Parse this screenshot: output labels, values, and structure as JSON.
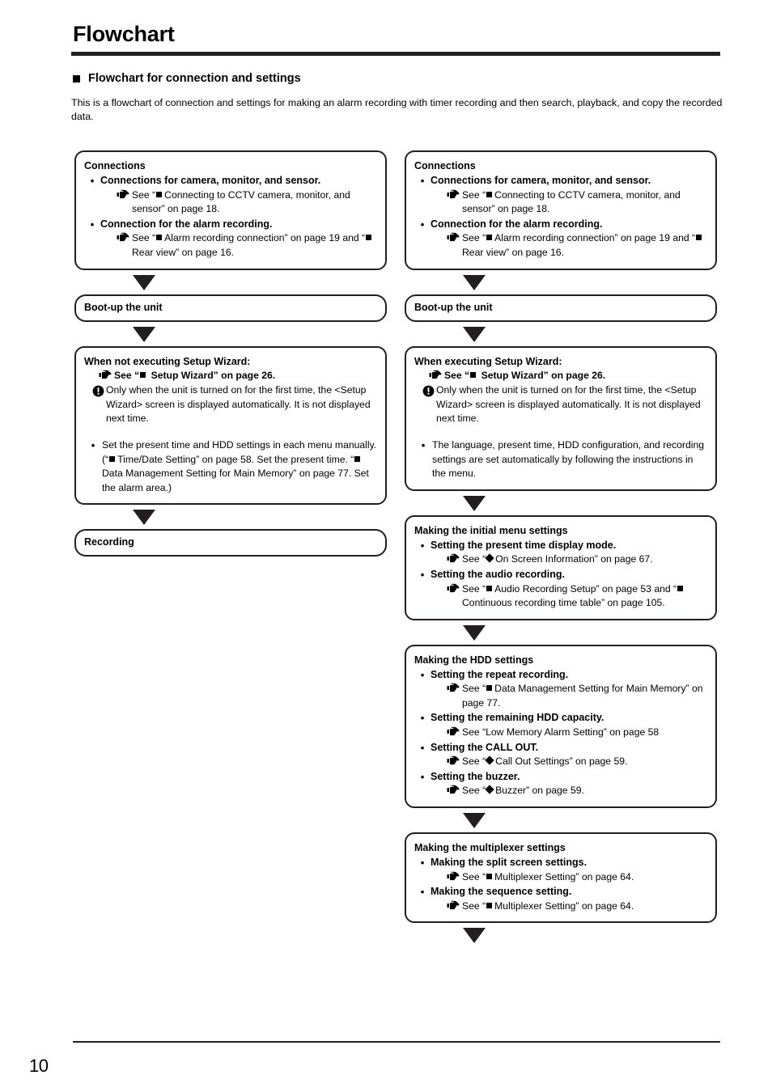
{
  "header": {
    "title": "Flowchart",
    "section_marker": "square-marker",
    "section_heading": "Flowchart for connection and settings",
    "intro": "This is a flowchart of connection and settings for making an alarm recording with timer recording and then search, playback, and copy the recorded data."
  },
  "footer": {
    "page_number": "10"
  },
  "icons": {
    "see_pointer": "pointing-hand-icon",
    "warning": "exclamation-circle-icon",
    "arrow": "down-triangle-arrow",
    "square_bullet": "filled-square-marker",
    "diamond_bullet": "filled-diamond-marker"
  },
  "left_column": {
    "box1": {
      "title": "Connections",
      "items": [
        {
          "label": "Connections for camera, monitor, and sensor.",
          "see_pre": "See “",
          "see_marker": "square",
          "see_post": "Connecting to CCTV camera, monitor, and sensor” on page 18."
        },
        {
          "label": "Connection for the alarm recording.",
          "see_pre": "See “",
          "see_marker": "square",
          "see_post": "Alarm recording connection” on page 19 and “",
          "see_marker2": "square",
          "see_post2": "Rear view” on page 16."
        }
      ]
    },
    "box2": {
      "title": "Boot-up the unit"
    },
    "box3": {
      "title": "When not executing Setup Wizard:",
      "see_pre": "See “",
      "see_marker": "square",
      "see_post": "Setup Wizard” on page 26.",
      "note": "Only when the unit is turned on for the first time, the <Setup Wizard> screen is displayed automatically. It is not displayed next time.",
      "bullet": "Set the present time and HDD settings in each menu manually. (“",
      "bullet_marker": "square",
      "bullet_mid": "Time/Date Setting” on page 58. Set the present time. “",
      "bullet_marker2": "square",
      "bullet_end": "Data Management Setting for Main Memory” on page 77. Set the alarm area.)"
    },
    "box4": {
      "title": "Recording"
    }
  },
  "right_column": {
    "box1": {
      "title": "Connections",
      "items": [
        {
          "label": "Connections for camera, monitor, and sensor.",
          "see_pre": "See “",
          "see_marker": "square",
          "see_post": "Connecting to CCTV camera, monitor, and sensor” on page 18."
        },
        {
          "label": "Connection for the alarm recording.",
          "see_pre": "See “",
          "see_marker": "square",
          "see_post": "Alarm recording connection” on page 19 and “",
          "see_marker2": "square",
          "see_post2": "Rear view” on page 16."
        }
      ]
    },
    "box2": {
      "title": "Boot-up the unit"
    },
    "box3": {
      "title": "When executing Setup Wizard:",
      "see_pre": "See “",
      "see_marker": "square",
      "see_post": "Setup Wizard” on page 26.",
      "note": "Only when the unit is turned on for the first time, the <Setup Wizard> screen is displayed automatically. It is not displayed next time.",
      "bullet": "The language, present time, HDD configuration, and recording settings are set automatically by following the instructions in the menu."
    },
    "box4": {
      "title": "Making the initial menu settings",
      "items": [
        {
          "label": "Setting the present time display mode.",
          "see_pre": "See “",
          "see_marker": "diamond",
          "see_post": "On Screen Information” on page 67."
        },
        {
          "label": "Setting the audio recording.",
          "see_pre": "See “",
          "see_marker": "square",
          "see_post": "Audio Recording Setup” on page 53 and “",
          "see_marker2": "square",
          "see_post2": "Continuous recording time table” on page 105."
        }
      ]
    },
    "box5": {
      "title": "Making the HDD settings",
      "items": [
        {
          "label": "Setting the repeat recording.",
          "see_pre": "See “",
          "see_marker": "square",
          "see_post": "Data Management Setting for Main Memory” on page 77."
        },
        {
          "label": "Setting the remaining HDD capacity.",
          "see_pre": "See “Low Memory Alarm Setting” on page 58",
          "see_marker": "none",
          "see_post": ""
        },
        {
          "label": "Setting the CALL OUT.",
          "see_pre": "See “",
          "see_marker": "diamond",
          "see_post": "Call Out Settings” on page 59."
        },
        {
          "label": "Setting the buzzer.",
          "see_pre": "See “",
          "see_marker": "diamond",
          "see_post": "Buzzer” on page 59."
        }
      ]
    },
    "box6": {
      "title": "Making the multiplexer settings",
      "items": [
        {
          "label": "Making the split screen settings.",
          "see_pre": "See “",
          "see_marker": "square",
          "see_post": "Multiplexer Setting” on page 64."
        },
        {
          "label": "Making the sequence setting.",
          "see_pre": "See “",
          "see_marker": "square",
          "see_post": "Multiplexer Setting” on page 64."
        }
      ]
    }
  }
}
